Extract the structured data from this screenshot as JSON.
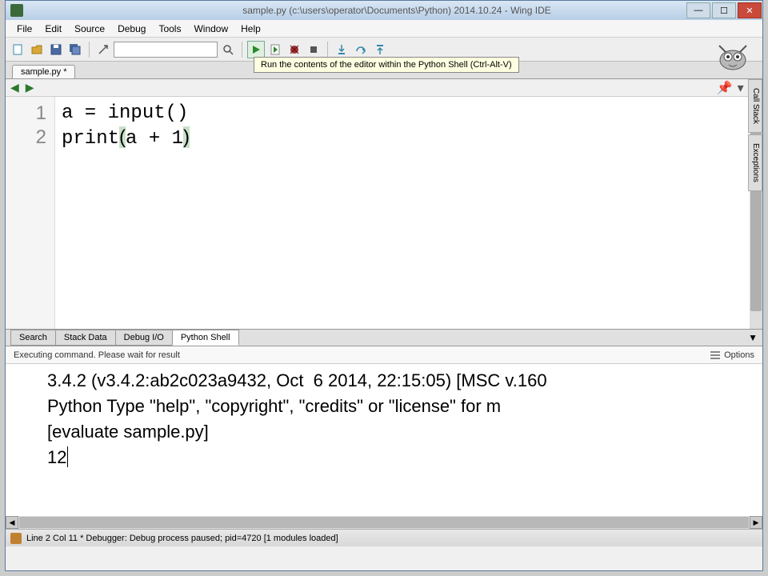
{
  "titlebar": {
    "text": "sample.py (c:\\users\\operator\\Documents\\Python) 2014.10.24 - Wing IDE"
  },
  "menus": [
    "File",
    "Edit",
    "Source",
    "Debug",
    "Tools",
    "Window",
    "Help"
  ],
  "tooltip": "Run the contents of the editor within the Python Shell (Ctrl-Alt-V)",
  "file_tab": "sample.py *",
  "code": {
    "lines": [
      {
        "n": "1",
        "text": "a = input()"
      },
      {
        "n": "2",
        "text": "print(a + 1)"
      }
    ]
  },
  "panel_tabs": [
    "Search",
    "Stack Data",
    "Debug I/O",
    "Python Shell"
  ],
  "panel_active": 3,
  "panel_header": "Executing command.  Please wait for result",
  "options_label": "Options",
  "shell_lines": [
    "3.4.2 (v3.4.2:ab2c023a9432, Oct  6 2014, 22:15:05) [MSC v.160",
    "Python Type \"help\", \"copyright\", \"credits\" or \"license\" for m",
    "[evaluate sample.py]",
    "12"
  ],
  "status": "Line 2 Col 11 * Debugger: Debug process paused; pid=4720 [1 modules loaded]",
  "side_tabs": [
    "Call Stack",
    "Exceptions"
  ]
}
